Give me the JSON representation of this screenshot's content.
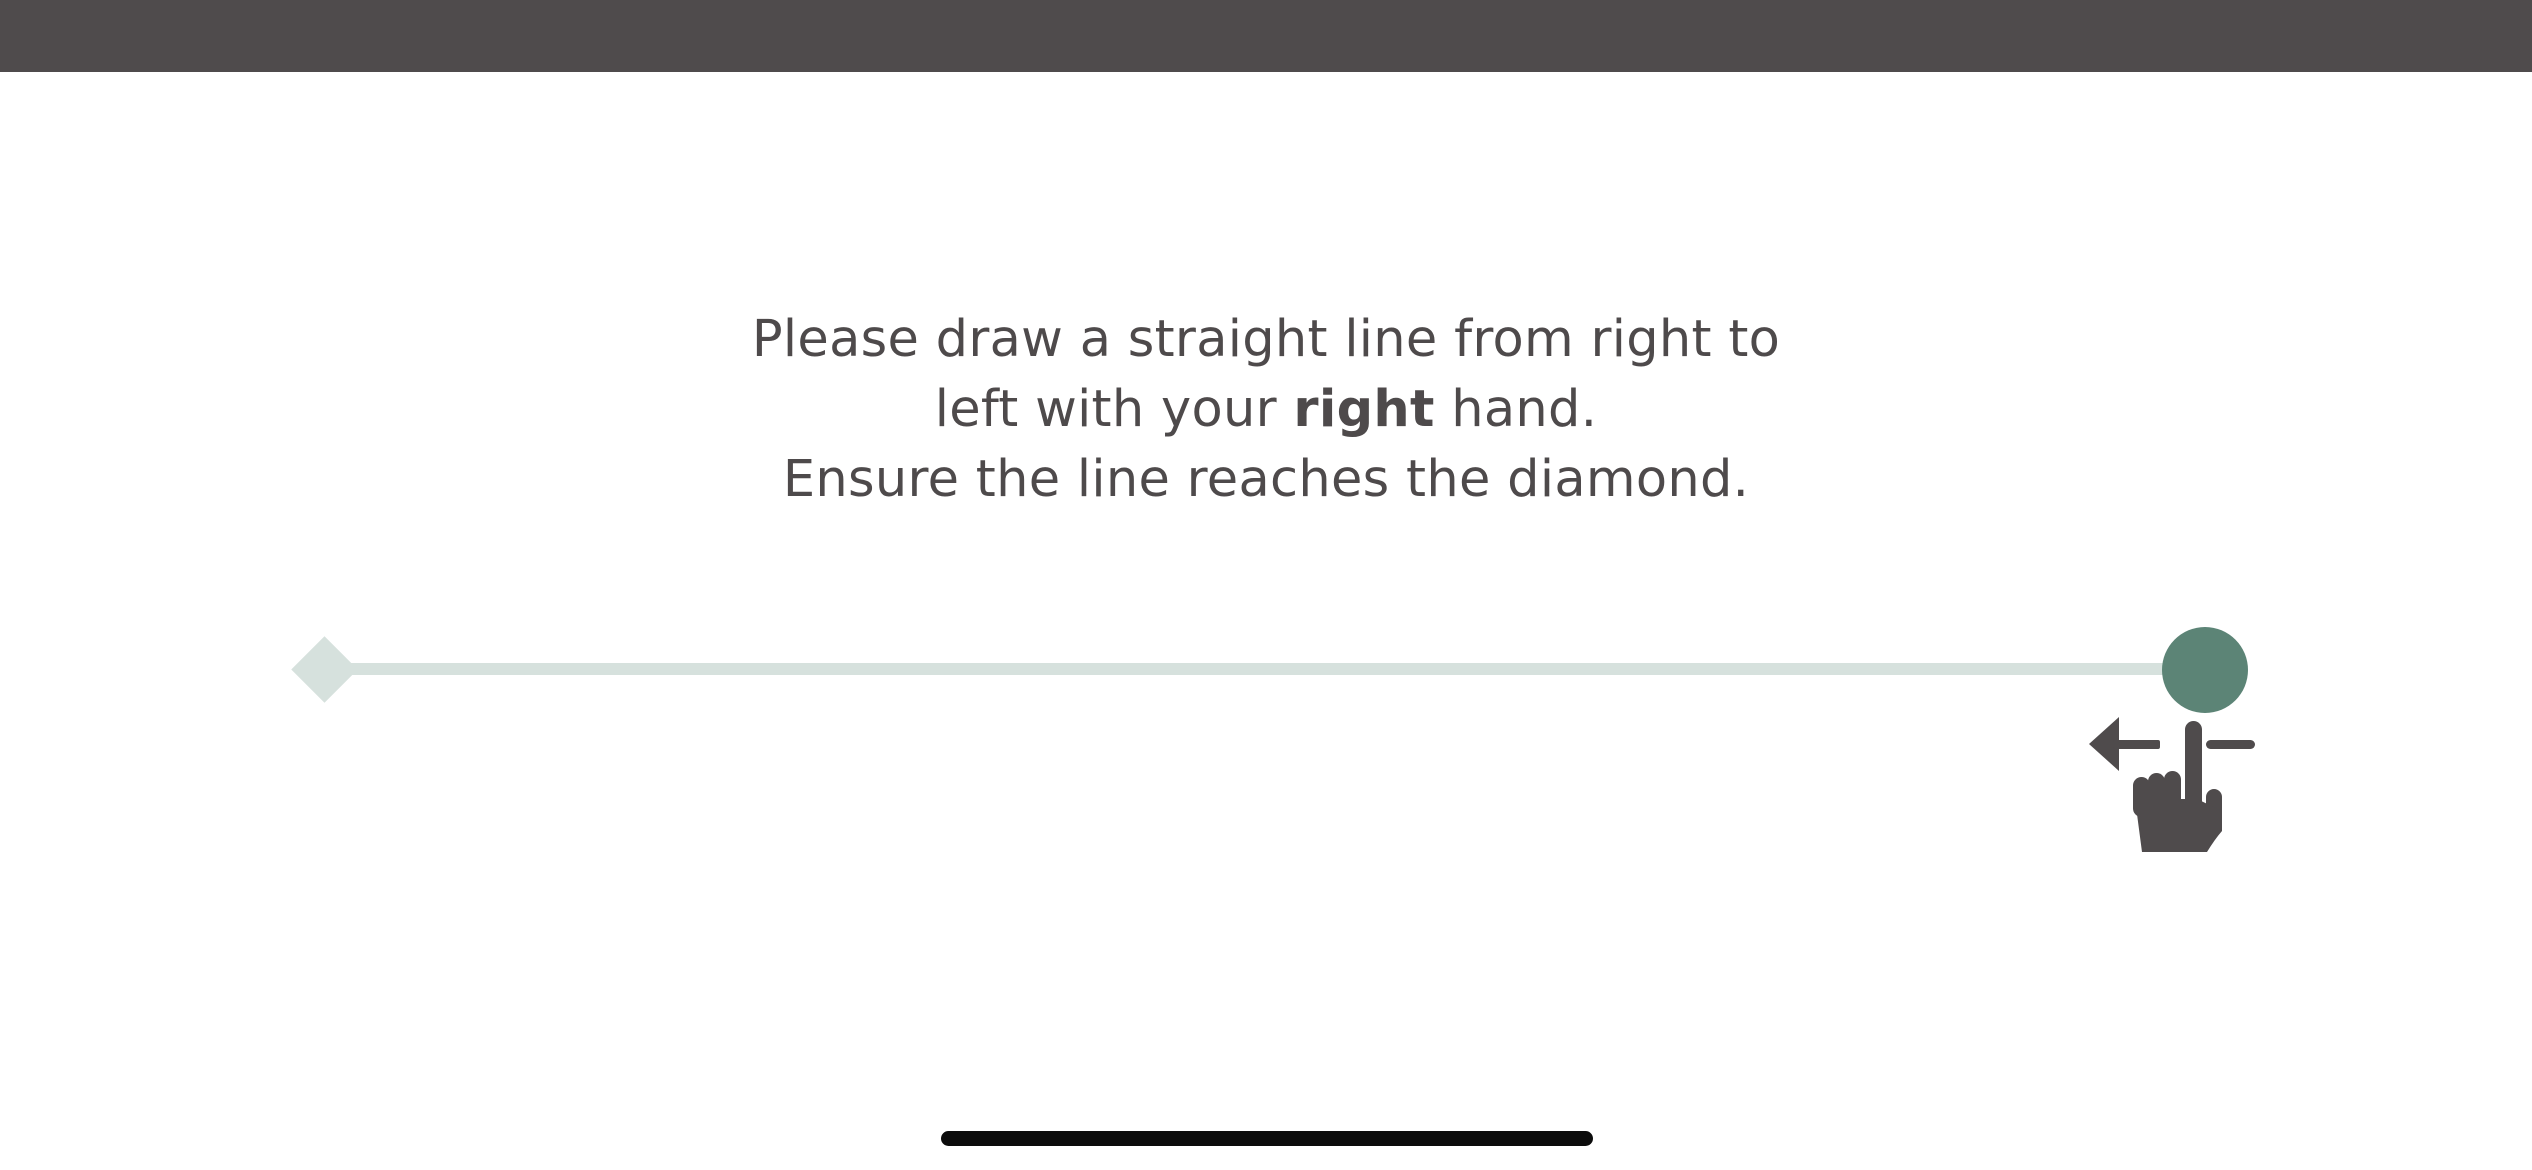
{
  "instructions": {
    "line1": "Please draw a straight line from right to",
    "line2_before": "left with your ",
    "line2_emphasis": "right",
    "line2_after": " hand.",
    "line3": "Ensure the line reaches the diamond."
  },
  "track": {
    "start_marker": "circle",
    "end_marker": "diamond",
    "direction": "right-to-left"
  },
  "colors": {
    "top_bar": "#4f4b4c",
    "text": "#4e4a4b",
    "track": "#d6e1dd",
    "start_dot": "#5c8476",
    "hand_icon": "#4f4b4c",
    "home_indicator": "#0c0c0c"
  },
  "icons": {
    "hint": "swipe-left-hand-icon",
    "target": "diamond-icon"
  }
}
